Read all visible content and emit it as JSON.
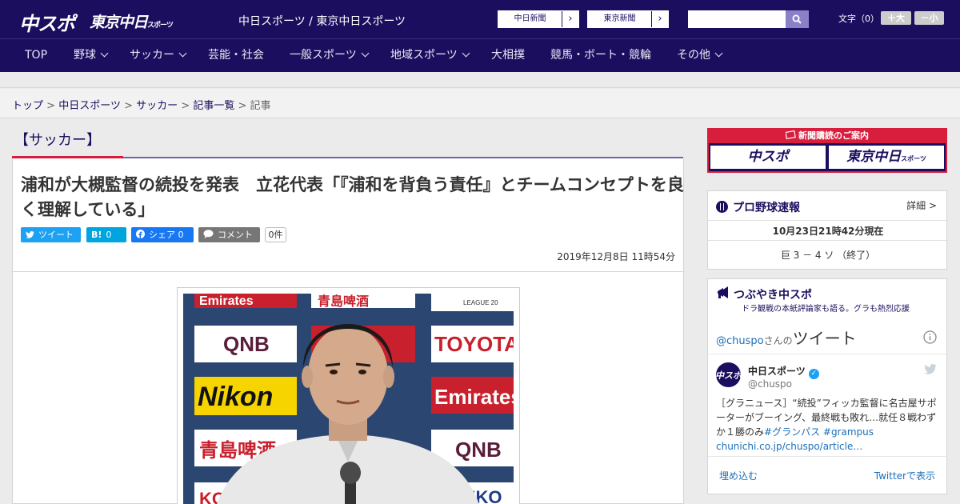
{
  "header": {
    "logo_chuspo": "中スポ",
    "logo_tokyo": "東京中日",
    "logo_tokyo_small": "スポーツ",
    "site_name": "中日スポーツ / 東京中日スポーツ",
    "paper_links": [
      {
        "label": "中日新聞",
        "arrow": "›"
      },
      {
        "label": "東京新聞",
        "arrow": "›"
      }
    ],
    "search_placeholder": "",
    "font_size_label": "文字（0）",
    "font_bigger": "＋大",
    "font_smaller": "－小"
  },
  "nav": {
    "items": [
      {
        "label": "TOP",
        "has_dropdown": false
      },
      {
        "label": "野球",
        "has_dropdown": true
      },
      {
        "label": "サッカー",
        "has_dropdown": true
      },
      {
        "label": "芸能・社会",
        "has_dropdown": false
      },
      {
        "label": "一般スポーツ",
        "has_dropdown": true
      },
      {
        "label": "地域スポーツ",
        "has_dropdown": true
      },
      {
        "label": "大相撲",
        "has_dropdown": false
      },
      {
        "label": "競馬・ボート・競輪",
        "has_dropdown": false
      },
      {
        "label": "その他",
        "has_dropdown": true
      }
    ]
  },
  "breadcrumb": {
    "items": [
      "トップ",
      "中日スポーツ",
      "サッカー",
      "記事一覧"
    ],
    "current": "記事",
    "separator": ">"
  },
  "category": {
    "title": "【サッカー】"
  },
  "article": {
    "headline": "浦和が大槻監督の続投を発表　立花代表「『浦和を背負う責任』とチームコンセプトを良く理解している」",
    "share": {
      "tweet": "ツイート",
      "hatena_icon": "B!",
      "hatena_count": "0",
      "facebook": "シェア 0",
      "comment": "コメント",
      "comment_count": "0件"
    },
    "date": "2019年12月8日 11時54分",
    "photo_backdrop": {
      "col1": [
        "Emirates",
        "QNB",
        "Nikon",
        "青島啤酒",
        "KO"
      ],
      "col2": [
        "青島啤酒",
        "TOYOTA",
        "",
        "Emirates",
        "QNB",
        "SEIKO"
      ],
      "league_text": "LEAGUE 20"
    }
  },
  "sidebar": {
    "promo": {
      "header": "新聞購読のご案内",
      "left": "中スポ",
      "right": "東京中日",
      "right_small": "スポーツ"
    },
    "baseball": {
      "title": "プロ野球速報",
      "detail_link": "詳細 >",
      "timestamp": "10月23日21時42分現在",
      "score": "巨 3 － 4 ソ （終了）"
    },
    "tweets": {
      "title": "つぶやき中スポ",
      "subtitle": "ドラ観戦の本紙評論家も語る。グラも熱烈応援",
      "handle": "@chuspo",
      "handle_suffix": "さんの",
      "tweets_word": "ツイート",
      "account_name": "中日スポーツ",
      "account_handle": "@chuspo",
      "tweet_text": "［グラニュース］“続投”フィッカ監督に名古屋サポーターがブーイング、最終戦も敗れ…就任８戦わずか１勝のみ",
      "tweet_hashtags": "#グランパス #grampus",
      "tweet_url": "chunichi.co.jp/chuspo/article…",
      "embed": "埋め込む",
      "view_on_twitter": "Twitterで表示"
    }
  },
  "colors": {
    "brand_navy": "#1b0e5e",
    "accent_red": "#d81e3c",
    "twitter": "#1da1f2",
    "hatena": "#00a4de",
    "facebook": "#1877f2"
  }
}
